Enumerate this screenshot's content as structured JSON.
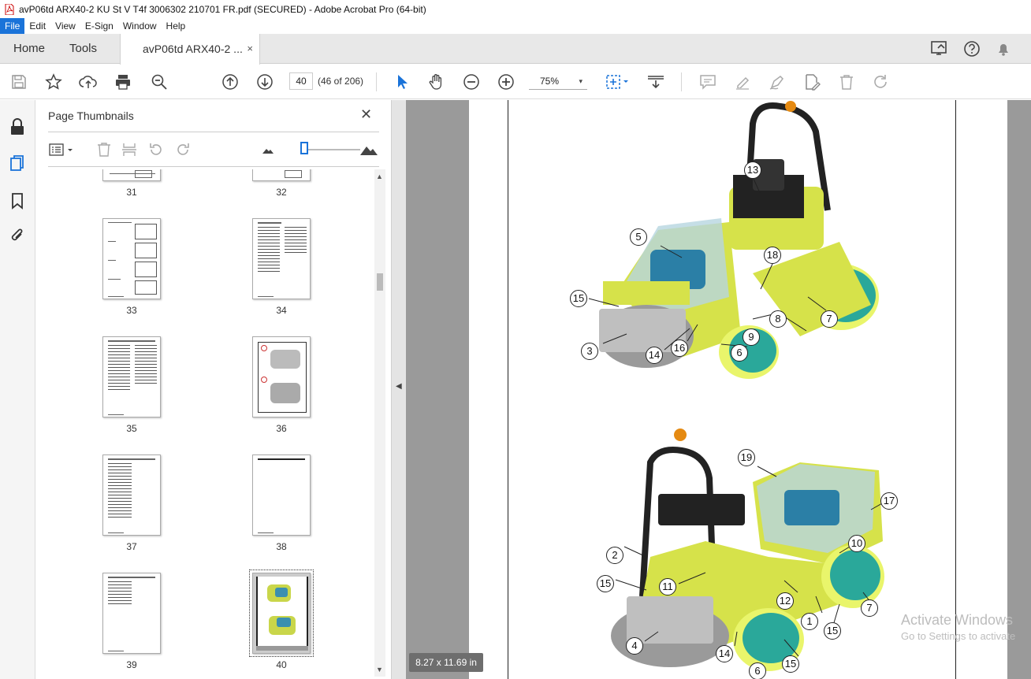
{
  "window": {
    "title": "avP06td ARX40-2 KU St V T4f 3006302 210701 FR.pdf (SECURED) - Adobe Acrobat Pro (64-bit)"
  },
  "menu": [
    "File",
    "Edit",
    "View",
    "E-Sign",
    "Window",
    "Help"
  ],
  "tabs": {
    "home": "Home",
    "tools": "Tools",
    "doc": "avP06td ARX40-2 ...",
    "close": "×"
  },
  "toolbar": {
    "page_number": "40",
    "page_count": "(46 of 206)",
    "zoom": "75%",
    "zoom_caret": "▾"
  },
  "panel": {
    "title": "Page Thumbnails",
    "close": "✕",
    "pages": [
      "31",
      "32",
      "33",
      "34",
      "35",
      "36",
      "37",
      "38",
      "39",
      "40"
    ],
    "selected_page": "40"
  },
  "callouts": [
    "13",
    "5",
    "18",
    "15",
    "8",
    "7",
    "9",
    "16",
    "3",
    "14",
    "6",
    "19",
    "17",
    "10",
    "2",
    "15",
    "11",
    "12",
    "7",
    "1",
    "15",
    "4",
    "14",
    "15",
    "6"
  ],
  "status": {
    "page_size": "8.27 x 11.69 in"
  },
  "watermark": {
    "line1": "Activate Windows",
    "line2": "Go to Settings to activate"
  },
  "colors": {
    "accent": "#1a73d9",
    "machine_yellow": "#d6e24a",
    "drum_teal": "#2aa89a"
  }
}
